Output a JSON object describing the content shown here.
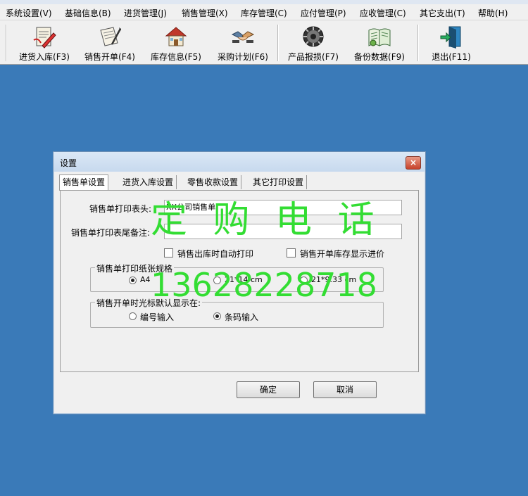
{
  "menu": [
    {
      "label": "系统设置(V)"
    },
    {
      "label": "基础信息(B)"
    },
    {
      "label": "进货管理(J)"
    },
    {
      "label": "销售管理(X)"
    },
    {
      "label": "库存管理(C)"
    },
    {
      "label": "应付管理(P)"
    },
    {
      "label": "应收管理(C)"
    },
    {
      "label": "其它支出(T)"
    },
    {
      "label": "帮助(H)"
    }
  ],
  "toolbar": [
    {
      "label": "进货入库(F3)",
      "icon": "stock-in-icon"
    },
    {
      "label": "销售开单(F4)",
      "icon": "sales-order-icon"
    },
    {
      "label": "库存信息(F5)",
      "icon": "warehouse-icon"
    },
    {
      "label": "采购计划(F6)",
      "icon": "handshake-icon"
    },
    {
      "label": "产品报损(F7)",
      "icon": "damage-report-icon"
    },
    {
      "label": "备份数据(F9)",
      "icon": "backup-icon"
    },
    {
      "label": "退出(F11)",
      "icon": "exit-icon"
    }
  ],
  "dialog": {
    "title": "设置",
    "close_label": "×",
    "tabs": [
      {
        "label": "销售单设置",
        "active": true
      },
      {
        "label": "进货入库设置"
      },
      {
        "label": "零售收款设置"
      },
      {
        "label": "其它打印设置"
      }
    ],
    "header_label": "销售单打印表头:",
    "header_value": "XX公司销售单",
    "footer_label": "销售单打印表尾备注:",
    "footer_value": "",
    "auto_print_label": "销售出库时自动打印",
    "show_cost_label": "销售开单库存显示进价",
    "paper_group_label": "销售单打印纸张规格",
    "paper_options": [
      "A4",
      "21*14 cm",
      "21*9.33 cm"
    ],
    "paper_selected": "A4",
    "cursor_group_label": "销售开单时光标默认显示在:",
    "cursor_options": [
      "编号输入",
      "条码输入"
    ],
    "cursor_selected": "条码输入",
    "ok_label": "确定",
    "cancel_label": "取消"
  },
  "watermark": {
    "line1": "定 购 电 话",
    "line2": "13628228718"
  },
  "colors": {
    "desktop": "#3a7ab8",
    "watermark": "#33dd33"
  }
}
